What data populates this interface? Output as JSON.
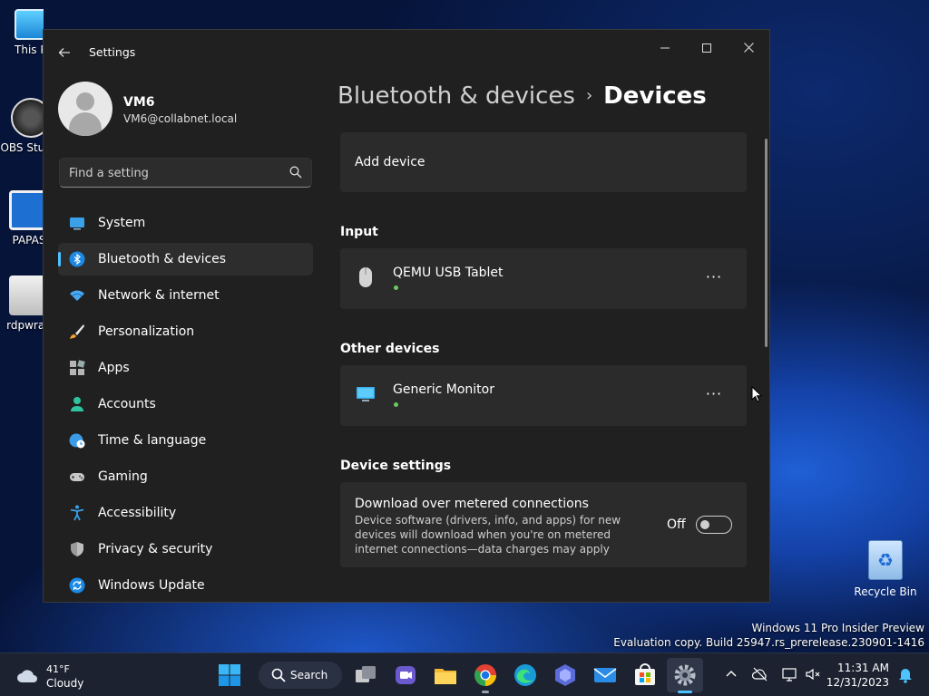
{
  "desktop": {
    "icons": [
      {
        "label": "This PC"
      },
      {
        "label": "OBS Studio"
      },
      {
        "label": "PAPAS"
      },
      {
        "label": "rdpwrap"
      }
    ],
    "recycle_bin": "Recycle Bin",
    "watermark_line1": "Windows 11 Pro Insider Preview",
    "watermark_line2": "Evaluation copy. Build 25947.rs_prerelease.230901-1416"
  },
  "window": {
    "title": "Settings",
    "controls": {
      "minimize": "—",
      "maximize": "☐",
      "close": "✕"
    }
  },
  "profile": {
    "name": "VM6",
    "email": "VM6@collabnet.local"
  },
  "search": {
    "placeholder": "Find a setting"
  },
  "nav": {
    "items": [
      {
        "label": "System",
        "icon": "monitor-icon"
      },
      {
        "label": "Bluetooth & devices",
        "icon": "bluetooth-icon"
      },
      {
        "label": "Network & internet",
        "icon": "wifi-icon"
      },
      {
        "label": "Personalization",
        "icon": "brush-icon"
      },
      {
        "label": "Apps",
        "icon": "apps-icon"
      },
      {
        "label": "Accounts",
        "icon": "person-icon"
      },
      {
        "label": "Time & language",
        "icon": "globe-clock-icon"
      },
      {
        "label": "Gaming",
        "icon": "gamepad-icon"
      },
      {
        "label": "Accessibility",
        "icon": "accessibility-icon"
      },
      {
        "label": "Privacy & security",
        "icon": "shield-icon"
      },
      {
        "label": "Windows Update",
        "icon": "update-icon"
      }
    ],
    "active": "Bluetooth & devices"
  },
  "breadcrumb": {
    "parent": "Bluetooth & devices",
    "separator": "›",
    "current": "Devices"
  },
  "content": {
    "add_device": "Add device",
    "input_section": "Input",
    "input_device": {
      "name": "QEMU USB Tablet",
      "more": "···"
    },
    "other_section": "Other devices",
    "other_device": {
      "name": "Generic Monitor",
      "more": "···"
    },
    "device_settings_section": "Device settings",
    "metered": {
      "title": "Download over metered connections",
      "description": "Device software (drivers, info, and apps) for new devices will download when you're on metered internet connections—data charges may apply",
      "toggle_label": "Off"
    }
  },
  "taskbar": {
    "weather_temp": "41°F",
    "weather_condition": "Cloudy",
    "search_label": "Search",
    "time": "11:31 AM",
    "date": "12/31/2023"
  },
  "colors": {
    "accent": "#4cc2ff",
    "window_bg": "#202020",
    "card_bg": "#2b2b2b",
    "status_green": "#6ccb5f"
  }
}
